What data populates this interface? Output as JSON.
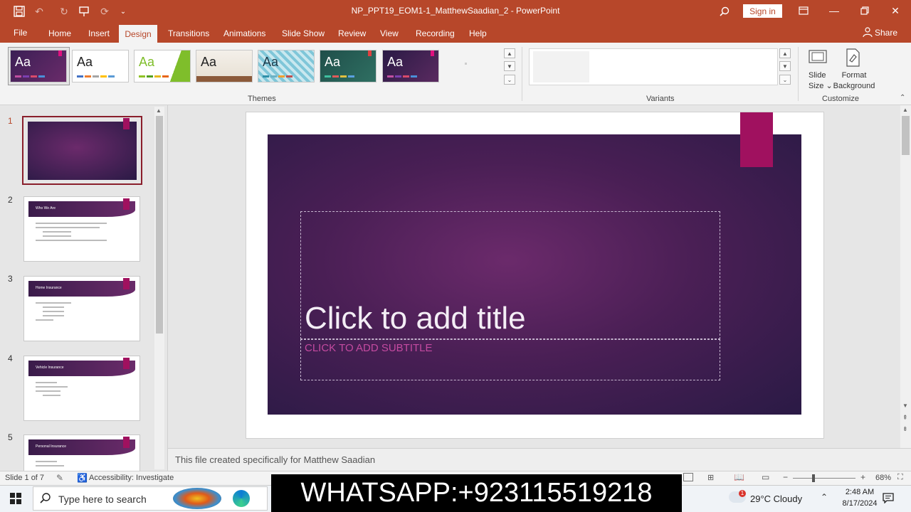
{
  "window": {
    "title": "NP_PPT19_EOM1-1_MatthewSaadian_2  -  PowerPoint",
    "sign_in": "Sign in",
    "share": "Share"
  },
  "menu": {
    "tabs": [
      "File",
      "Home",
      "Insert",
      "Design",
      "Transitions",
      "Animations",
      "Slide Show",
      "Review",
      "View",
      "Recording",
      "Help"
    ]
  },
  "ribbon": {
    "themes_label": "Themes",
    "variants_label": "Variants",
    "customize_label": "Customize",
    "slide_size": [
      "Slide",
      "Size"
    ],
    "format_background": [
      "Format",
      "Background"
    ],
    "theme_preview_text": "Aa"
  },
  "thumbnails": {
    "numbers": [
      "1",
      "2",
      "3",
      "4",
      "5"
    ],
    "titles": [
      "",
      "Who We Are",
      "Home Insurance",
      "Vehicle Insurance",
      "Personal Insurance"
    ]
  },
  "slide": {
    "title_placeholder": "Click to add title",
    "subtitle_placeholder": "CLICK TO ADD SUBTITLE"
  },
  "notes": {
    "text": "This file created specifically for Matthew Saadian"
  },
  "status": {
    "slide_count": "Slide 1 of 7",
    "accessibility": "Accessibility: Investigate",
    "zoom": "68%"
  },
  "taskbar": {
    "search_placeholder": "Type here to search",
    "weather": "29°C  Cloudy",
    "time": "2:48 AM",
    "date": "8/17/2024",
    "weather_badge": "1"
  },
  "overlay": {
    "whatsapp": "WHATSAPP:+923115519218"
  },
  "colors": {
    "brand": "#b7472a",
    "accent": "#a0115f",
    "slide_dark": "#2a1a45"
  }
}
